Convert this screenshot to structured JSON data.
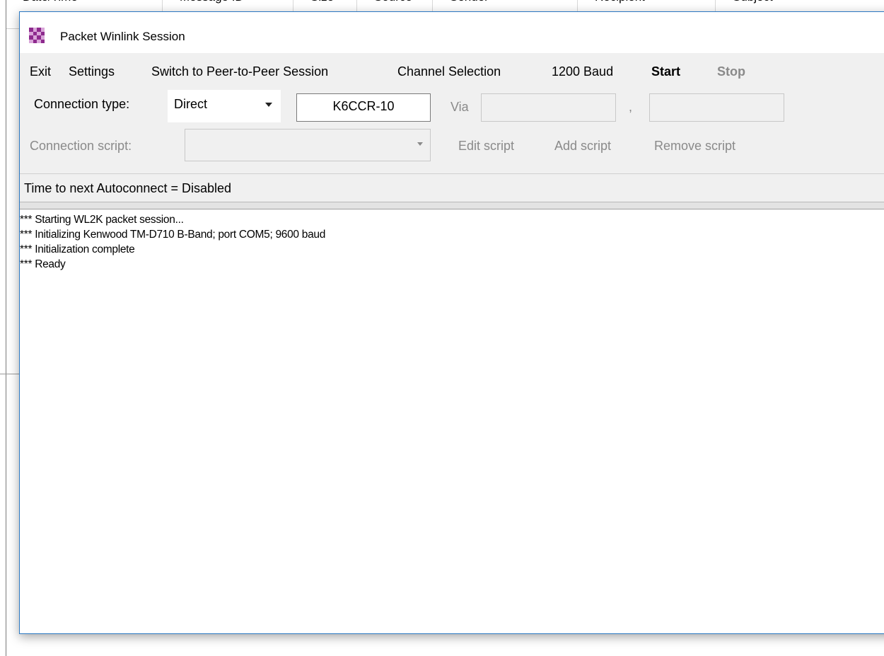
{
  "background": {
    "columns": [
      "Date/Time",
      "Message ID",
      "Size",
      "Source",
      "Sender",
      "Recipient",
      "Subject"
    ]
  },
  "dialog": {
    "title": "Packet Winlink Session",
    "icon": "checkered-app-icon"
  },
  "menu": {
    "items": [
      {
        "label": "Exit"
      },
      {
        "label": "Settings"
      },
      {
        "label": "Switch to Peer-to-Peer Session"
      },
      {
        "label": "Channel Selection"
      },
      {
        "label": "1200 Baud"
      },
      {
        "label": "Start"
      },
      {
        "label": "Stop"
      }
    ]
  },
  "connection": {
    "type_label": "Connection type:",
    "type_value": "Direct",
    "callsign": "K6CCR-10",
    "via_label": "Via",
    "separator": ",",
    "via1": "",
    "via2": ""
  },
  "script": {
    "label": "Connection script:",
    "value": "",
    "edit_label": "Edit script",
    "add_label": "Add script",
    "remove_label": "Remove script"
  },
  "status": {
    "autoconnect_text": "Time to next Autoconnect = Disabled"
  },
  "log": {
    "lines": [
      "*** Starting WL2K packet session...",
      "*** Initializing Kenwood TM-D710 B-Band; port COM5; 9600 baud",
      "*** Initialization complete",
      "*** Ready"
    ]
  },
  "colors": {
    "dialog_border": "#2b78c2",
    "icon_a": "#8e2a8e",
    "icon_b": "#d9a6d9"
  }
}
